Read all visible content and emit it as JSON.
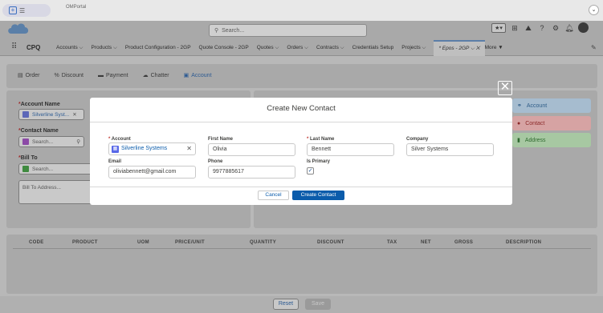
{
  "browser": {
    "tab_title": "OMPortal"
  },
  "header": {
    "search_placeholder": "Search...",
    "star_label": "★▾"
  },
  "nav": {
    "app_name": "CPQ",
    "items": [
      {
        "label": "Accounts ⌵"
      },
      {
        "label": "Products ⌵"
      },
      {
        "label": "Product Configuration - 2GP"
      },
      {
        "label": "Quote Console - 2GP"
      },
      {
        "label": "Quotes ⌵"
      },
      {
        "label": "Orders ⌵"
      },
      {
        "label": "Contracts ⌵"
      },
      {
        "label": "Credentials Setup"
      },
      {
        "label": "Projects ⌵"
      }
    ],
    "active_tab": "* Epos - 2GP ⌵ ✕",
    "more": "More ▼"
  },
  "page": {
    "tabs": [
      "Order",
      "Discount",
      "Payment",
      "Chatter",
      "Account"
    ],
    "account_label": "Account Name",
    "account_value": "Silverline Syst...",
    "contact_label": "Contact Name",
    "contact_placeholder": "Search...",
    "billto_label": "Bill To",
    "billto_placeholder": "Search...",
    "billto_address_placeholder": "Bill To Address...",
    "right_pills": [
      "Account",
      "Contact",
      "Address"
    ],
    "table_headers": [
      "CODE",
      "PRODUCT",
      "UOM",
      "PRICE/UNIT",
      "QUANTITY",
      "DISCOUNT",
      "TAX",
      "NET",
      "GROSS",
      "DESCRIPTION"
    ],
    "reset_label": "Reset",
    "save_label": "Save"
  },
  "modal": {
    "title": "Create New Contact",
    "close_glyph": "✕",
    "account_label": "Account",
    "account_value": "Silverline Systems",
    "first_name_label": "First Name",
    "first_name_value": "Olivia",
    "last_name_label": "Last Name",
    "last_name_value": "Bennett",
    "company_label": "Company",
    "company_value": "Silver Systems",
    "email_label": "Email",
    "email_value": "oliviabennett@gmail.com",
    "phone_label": "Phone",
    "phone_value": "9977885617",
    "is_primary_label": "Is Primary",
    "is_primary_checked": true,
    "cancel_label": "Cancel",
    "create_label": "Create Contact"
  },
  "colors": {
    "brand_blue": "#0b5cab",
    "required_red": "#c23934",
    "account_pill": "#a6bccf",
    "contact_pill": "#d6a3a3",
    "address_pill": "#a7c8a2"
  }
}
